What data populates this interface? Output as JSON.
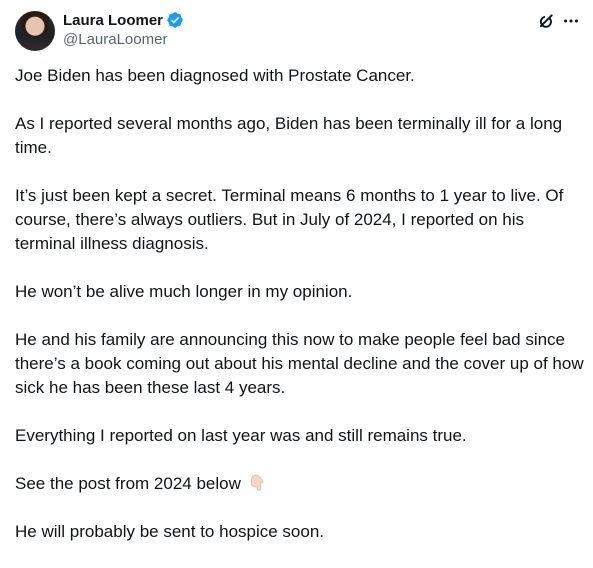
{
  "author": {
    "display_name": "Laura Loomer",
    "handle": "@LauraLoomer"
  },
  "icons": {
    "verified": "verified-badge-icon",
    "grok": "grok-icon",
    "more": "more-icon",
    "emoji": "pointing-down-emoji"
  },
  "colors": {
    "text": "#0f1419",
    "secondary": "#536471",
    "verified_blue": "#1d9bf0"
  },
  "post": {
    "paragraphs": [
      "Joe Biden has been diagnosed with Prostate Cancer.",
      "As I reported several months ago, Biden has been terminally ill for a long time.",
      "It’s just been kept a secret. Terminal means 6 months to 1 year to live. Of course, there’s always outliers. But in July of 2024, I reported on his terminal illness diagnosis.",
      "He won’t be alive much longer in my opinion.",
      "He and his family are announcing this now to make people feel bad since there’s a book coming out about his mental decline and the cover up of how sick he has been these last 4 years.",
      "Everything I reported on last year was and still remains true.",
      "See the post from 2024 below",
      "He will probably be sent to hospice soon."
    ]
  }
}
